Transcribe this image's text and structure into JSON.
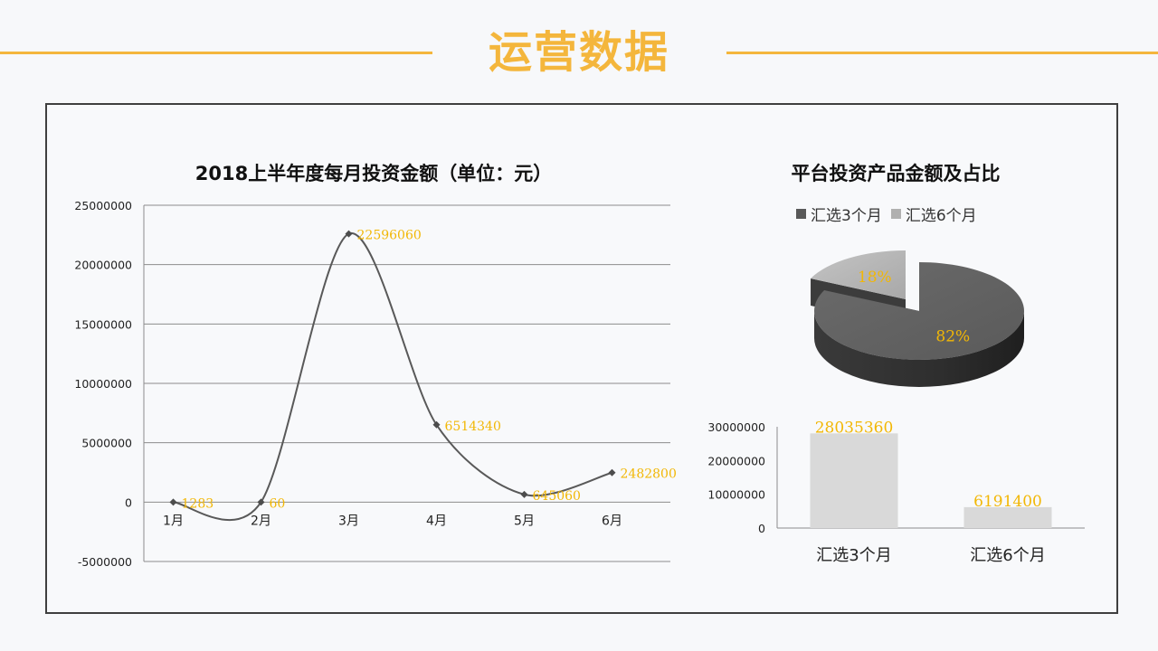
{
  "page": {
    "title": "运营数据"
  },
  "colors": {
    "accent": "#f4b63c",
    "label": "#f2b705",
    "line": "#595959",
    "pie_dark": "#595959",
    "pie_light": "#b0b0b0",
    "bar": "#d9d9d9"
  },
  "chart_data": [
    {
      "type": "line",
      "title": "2018上半年度每月投资金额（单位：元）",
      "xlabel": "",
      "ylabel": "",
      "categories": [
        "1月",
        "2月",
        "3月",
        "4月",
        "5月",
        "6月"
      ],
      "values": [
        1283,
        60,
        22596060,
        6514340,
        645060,
        2482800
      ],
      "data_labels": [
        "1283",
        "60",
        "22596060",
        "6514340",
        "645060",
        "2482800"
      ],
      "y_ticks": [
        "25000000",
        "20000000",
        "15000000",
        "10000000",
        "5000000",
        "0",
        "-5000000"
      ],
      "ylim": [
        -5000000,
        25000000
      ],
      "smooth": true,
      "grid": true
    },
    {
      "type": "pie",
      "title": "平台投资产品金额及占比",
      "labels": [
        "汇选3个月",
        "汇选6个月"
      ],
      "values": [
        82,
        18
      ],
      "data_labels": [
        "82%",
        "18%"
      ],
      "legend": "top",
      "style": "3d-exploded"
    },
    {
      "type": "bar",
      "categories": [
        "汇选3个月",
        "汇选6个月"
      ],
      "values": [
        28035360,
        6191400
      ],
      "data_labels": [
        "28035360",
        "6191400"
      ],
      "y_ticks": [
        "30000000",
        "20000000",
        "10000000",
        "0"
      ],
      "ylim": [
        0,
        30000000
      ]
    }
  ]
}
